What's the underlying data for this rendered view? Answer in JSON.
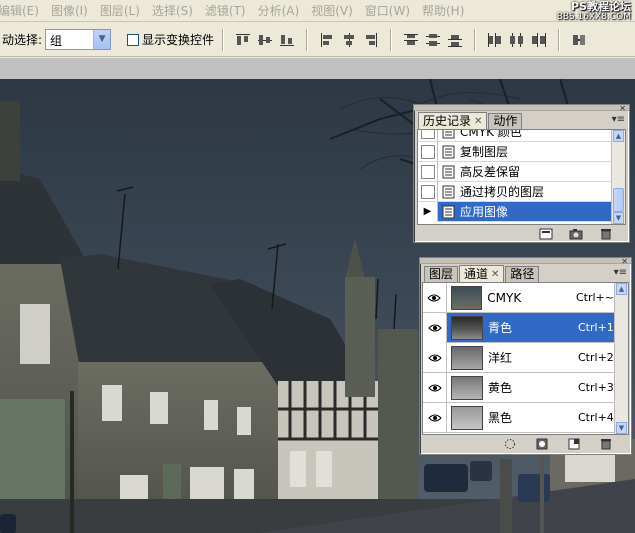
{
  "menu": [
    "编辑(E)",
    "图像(I)",
    "图层(L)",
    "选择(S)",
    "滤镜(T)",
    "分析(A)",
    "视图(V)",
    "窗口(W)",
    "帮助(H)"
  ],
  "watermark": {
    "title": "PS教程论坛",
    "url": "BBS.16XX8.COM"
  },
  "options": {
    "auto_select_label": "动选择:",
    "auto_select_value": "组",
    "show_transform_label": "显示变换控件"
  },
  "history_panel": {
    "tabs": [
      "历史记录",
      "动作"
    ],
    "items": [
      {
        "label": "CMYK 颜色",
        "selected": false
      },
      {
        "label": "复制图层",
        "selected": false
      },
      {
        "label": "高反差保留",
        "selected": false
      },
      {
        "label": "通过拷贝的图层",
        "selected": false
      },
      {
        "label": "应用图像",
        "selected": true
      }
    ]
  },
  "channels_panel": {
    "tabs": [
      "图层",
      "通道",
      "路径"
    ],
    "active_tab": "通道",
    "items": [
      {
        "name": "CMYK",
        "shortcut": "Ctrl+~",
        "selected": false
      },
      {
        "name": "青色",
        "shortcut": "Ctrl+1",
        "selected": true
      },
      {
        "name": "洋红",
        "shortcut": "Ctrl+2",
        "selected": false
      },
      {
        "name": "黄色",
        "shortcut": "Ctrl+3",
        "selected": false
      },
      {
        "name": "黑色",
        "shortcut": "Ctrl+4",
        "selected": false
      }
    ]
  },
  "colors": {
    "selection": "#3169c6",
    "panel_bg": "#d4d0c8",
    "sky": "#3c4855"
  }
}
